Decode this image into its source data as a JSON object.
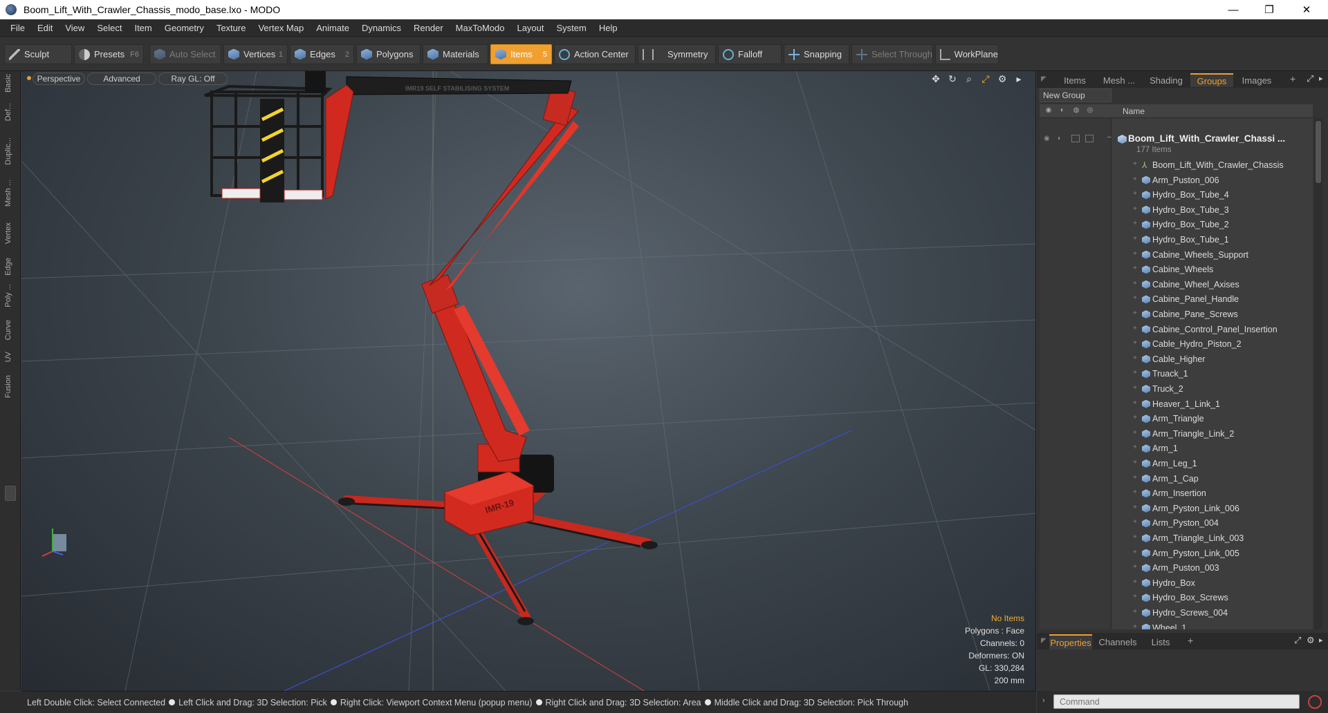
{
  "window": {
    "title": "Boom_Lift_With_Crawler_Chassis_modo_base.lxo - MODO",
    "minimize": "—",
    "maximize": "❐",
    "close": "✕"
  },
  "menu": [
    "File",
    "Edit",
    "View",
    "Select",
    "Item",
    "Geometry",
    "Texture",
    "Vertex Map",
    "Animate",
    "Dynamics",
    "Render",
    "MaxToModo",
    "Layout",
    "System",
    "Help"
  ],
  "toolbar": {
    "sculpt": "Sculpt",
    "presets": "Presets",
    "presets_key": "F6",
    "auto_select": "Auto Select",
    "vertices": "Vertices",
    "vertices_key": "1",
    "edges": "Edges",
    "edges_key": "2",
    "polygons": "Polygons",
    "materials": "Materials",
    "items": "Items",
    "items_key": "5",
    "action_center": "Action Center",
    "symmetry": "Symmetry",
    "falloff": "Falloff",
    "snapping": "Snapping",
    "select_through": "Select Through",
    "workplane": "WorkPlane"
  },
  "left_tabs": [
    "Basic",
    "Def...",
    "Duplic...",
    "Mesh ...",
    "Vertex",
    "Edge",
    "Poly ...",
    "Curve",
    "UV",
    "Fusion"
  ],
  "viewport": {
    "perspective": "Perspective",
    "advanced": "Advanced",
    "raygl": "Ray GL: Off",
    "info": {
      "no_items": "No Items",
      "polygons": "Polygons : Face",
      "channels": "Channels: 0",
      "deformers": "Deformers: ON",
      "gl": "GL: 330,284",
      "scale": "200 mm"
    },
    "model_decals": {
      "boom_text": "IMR19 SELF STABILISING SYSTEM",
      "chassis_text": "IMR-19"
    }
  },
  "status": {
    "hints": [
      "Left Double Click: Select Connected",
      "Left Click and Drag: 3D Selection: Pick",
      "Right Click: Viewport Context Menu (popup menu)",
      "Right Click and Drag: 3D Selection: Area",
      "Middle Click and Drag: 3D Selection: Pick Through"
    ]
  },
  "right_panel": {
    "tabs": [
      "Items",
      "Mesh ...",
      "Shading",
      "Groups",
      "Images"
    ],
    "active_tab": "Groups",
    "new_group": "New Group",
    "name_header": "Name",
    "group": {
      "name": "Boom_Lift_With_Crawler_Chassi ...",
      "count": "177 Items"
    },
    "items": [
      "Boom_Lift_With_Crawler_Chassis",
      "Arm_Puston_006",
      "Hydro_Box_Tube_4",
      "Hydro_Box_Tube_3",
      "Hydro_Box_Tube_2",
      "Hydro_Box_Tube_1",
      "Cabine_Wheels_Support",
      "Cabine_Wheels",
      "Cabine_Wheel_Axises",
      "Cabine_Panel_Handle",
      "Cabine_Pane_Screws",
      "Cabine_Control_Panel_Insertion",
      "Cable_Hydro_Piston_2",
      "Cable_Higher",
      "Truack_1",
      "Truck_2",
      "Heaver_1_Link_1",
      "Arm_Triangle",
      "Arm_Triangle_Link_2",
      "Arm_1",
      "Arm_Leg_1",
      "Arm_1_Cap",
      "Arm_Insertion",
      "Arm_Pyston_Link_006",
      "Arm_Pyston_004",
      "Arm_Triangle_Link_003",
      "Arm_Pyston_Link_005",
      "Arm_Puston_003",
      "Hydro_Box",
      "Hydro_Box_Screws",
      "Hydro_Screws_004",
      "Wheel_1"
    ],
    "bottom_tabs": [
      "Properties",
      "Channels",
      "Lists"
    ],
    "active_bottom": "Properties",
    "command_placeholder": "Command"
  }
}
